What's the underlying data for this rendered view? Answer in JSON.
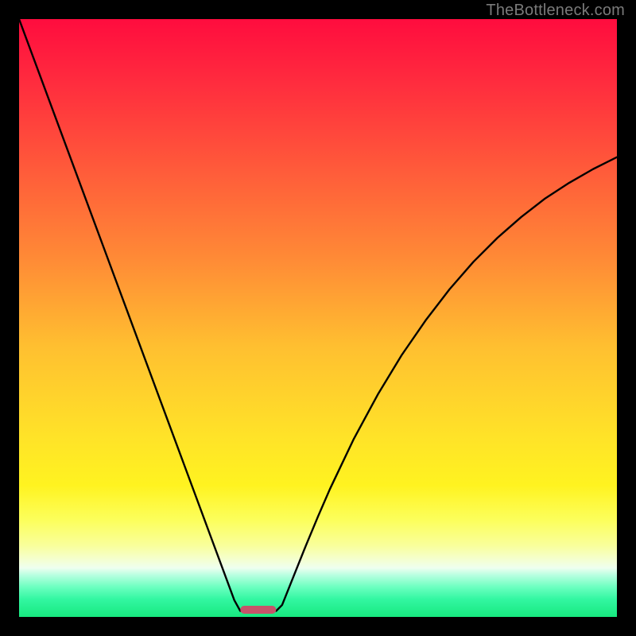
{
  "watermark": "TheBottleneck.com",
  "colors": {
    "frame": "#000000",
    "gradient_stops": [
      {
        "offset": 0.0,
        "color": "#ff0c3e"
      },
      {
        "offset": 0.1,
        "color": "#ff2a3e"
      },
      {
        "offset": 0.25,
        "color": "#ff5a3a"
      },
      {
        "offset": 0.4,
        "color": "#ff8a36"
      },
      {
        "offset": 0.55,
        "color": "#ffc030"
      },
      {
        "offset": 0.7,
        "color": "#ffe328"
      },
      {
        "offset": 0.78,
        "color": "#fff320"
      },
      {
        "offset": 0.84,
        "color": "#fcff5e"
      },
      {
        "offset": 0.88,
        "color": "#f9ff9a"
      },
      {
        "offset": 0.905,
        "color": "#f4ffd2"
      },
      {
        "offset": 0.918,
        "color": "#eefff0"
      },
      {
        "offset": 0.93,
        "color": "#b8ffe0"
      },
      {
        "offset": 0.95,
        "color": "#6cffc0"
      },
      {
        "offset": 0.97,
        "color": "#33f7a2"
      },
      {
        "offset": 1.0,
        "color": "#17e97f"
      }
    ],
    "curve": "#000000",
    "marker_fill": "#c6546a",
    "marker_stroke": "#b94a60"
  },
  "chart_data": {
    "type": "line",
    "title": "",
    "xlabel": "",
    "ylabel": "",
    "xlim": [
      0,
      100
    ],
    "ylim": [
      0,
      100
    ],
    "legend": false,
    "grid": false,
    "x": [
      0,
      2,
      4,
      6,
      8,
      10,
      12,
      14,
      16,
      18,
      20,
      22,
      24,
      26,
      28,
      30,
      32,
      34,
      36,
      37,
      38,
      39,
      40,
      41,
      42,
      43,
      44,
      46,
      48,
      50,
      52,
      56,
      60,
      64,
      68,
      72,
      76,
      80,
      84,
      88,
      92,
      96,
      100
    ],
    "values": [
      100,
      94.6,
      89.2,
      83.8,
      78.4,
      73.0,
      67.6,
      62.2,
      56.8,
      51.4,
      46.0,
      40.6,
      35.2,
      29.8,
      24.4,
      19.0,
      13.6,
      8.2,
      2.8,
      1.0,
      1.0,
      1.0,
      1.0,
      1.0,
      1.0,
      1.0,
      2.0,
      7.0,
      12.0,
      16.8,
      21.4,
      29.8,
      37.2,
      43.8,
      49.6,
      54.8,
      59.4,
      63.4,
      66.9,
      70.0,
      72.6,
      74.9,
      76.9
    ],
    "marker": {
      "x_start": 37,
      "x_end": 43,
      "y": 1.2
    },
    "notes": "V-shaped bottleneck curve on a vertical green-to-red gradient; minimum (optimal) occurs at x≈37–43 where y≈0 (green zone). Values are visual estimates; the source image has no axis ticks or numeric labels."
  }
}
